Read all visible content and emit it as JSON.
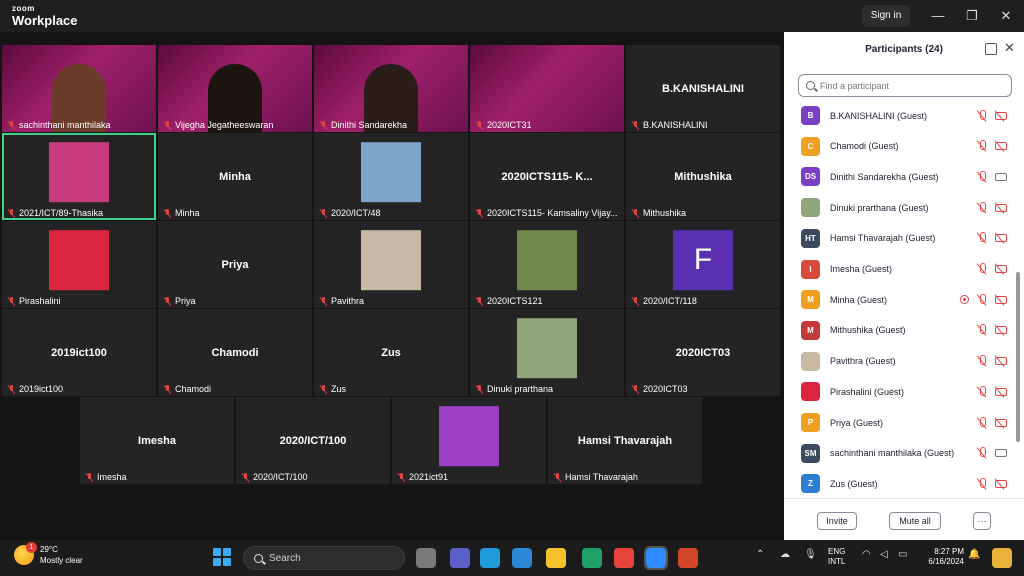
{
  "titlebar": {
    "brand_top": "zoom",
    "brand_bottom": "Workplace",
    "signin_label": "Sign in",
    "minimize_glyph": "—",
    "restore_glyph": "❐",
    "close_glyph": "✕"
  },
  "tiles": [
    {
      "label": "sachinthani manthilaka",
      "name": "",
      "kind": "banner"
    },
    {
      "label": "Vijegha Jegatheeswaran",
      "name": "",
      "kind": "banner"
    },
    {
      "label": "Dinithi Sandarekha",
      "name": "",
      "kind": "banner"
    },
    {
      "label": "2020ICT31",
      "name": "",
      "kind": "banner"
    },
    {
      "label": "B.KANISHALINI",
      "name": "B.KANISHALINI",
      "kind": "name"
    },
    {
      "label": "2021/ICT/89-Thasika",
      "name": "",
      "kind": "photo",
      "color": "#c73a7f"
    },
    {
      "label": "Minha",
      "name": "Minha",
      "kind": "name"
    },
    {
      "label": "2020/ICT/48",
      "name": "",
      "kind": "photo",
      "color": "#7ea4c9"
    },
    {
      "label": "2020ICTS115- Kamsaliny Vijay...",
      "name": "2020ICTS115- K...",
      "kind": "name"
    },
    {
      "label": "Mithushika",
      "name": "Mithushika",
      "kind": "name"
    },
    {
      "label": "Pirashalini",
      "name": "",
      "kind": "photo",
      "color": "#d9263e"
    },
    {
      "label": "Priya",
      "name": "Priya",
      "kind": "name"
    },
    {
      "label": "Pavithra",
      "name": "",
      "kind": "photo",
      "color": "#c9b9a4"
    },
    {
      "label": "2020ICTS121",
      "name": "",
      "kind": "photo",
      "color": "#6f8a4a"
    },
    {
      "label": "2020/ICT/118",
      "name": "",
      "kind": "letter",
      "letter": "F",
      "color": "#5a2fb0"
    },
    {
      "label": "2019ict100",
      "name": "2019ict100",
      "kind": "name"
    },
    {
      "label": "Chamodi",
      "name": "Chamodi",
      "kind": "name"
    },
    {
      "label": "Zus",
      "name": "Zus",
      "kind": "name"
    },
    {
      "label": "Dinuki prarthana",
      "name": "",
      "kind": "photo",
      "color": "#8fa57a"
    },
    {
      "label": "2020ICT03",
      "name": "2020ICT03",
      "kind": "name"
    },
    {
      "label": "Imesha",
      "name": "Imesha",
      "kind": "name"
    },
    {
      "label": "2020/ICT/100",
      "name": "2020/ICT/100",
      "kind": "name"
    },
    {
      "label": "2021ict91",
      "name": "",
      "kind": "photo",
      "color": "#9b3fc4"
    },
    {
      "label": "Hamsi Thavarajah",
      "name": "Hamsi Thavarajah",
      "kind": "name"
    }
  ],
  "panel": {
    "title": "Participants (24)",
    "search_placeholder": "Find a participant",
    "invite_label": "Invite",
    "mute_all_label": "Mute all",
    "more_label": "···",
    "participants": [
      {
        "initials": "B",
        "name": "B.KANISHALINI (Guest)",
        "color": "#7b3fc4",
        "cam_on": false,
        "rec": false
      },
      {
        "initials": "C",
        "name": "Chamodi (Guest)",
        "color": "#f0a020",
        "cam_on": false,
        "rec": false
      },
      {
        "initials": "DS",
        "name": "Dinithi Sandarekha (Guest)",
        "color": "#7b3fc4",
        "cam_on": true,
        "rec": false
      },
      {
        "initials": "",
        "name": "Dinuki prarthana (Guest)",
        "color": "#8fa57a",
        "cam_on": false,
        "rec": false
      },
      {
        "initials": "HT",
        "name": "Hamsi Thavarajah (Guest)",
        "color": "#3b4a5e",
        "cam_on": false,
        "rec": false
      },
      {
        "initials": "I",
        "name": "Imesha (Guest)",
        "color": "#d94a3a",
        "cam_on": false,
        "rec": false
      },
      {
        "initials": "M",
        "name": "Minha (Guest)",
        "color": "#f0a020",
        "cam_on": false,
        "rec": true
      },
      {
        "initials": "M",
        "name": "Mithushika (Guest)",
        "color": "#c23a3a",
        "cam_on": false,
        "rec": false
      },
      {
        "initials": "",
        "name": "Pavithra (Guest)",
        "color": "#c9b9a4",
        "cam_on": false,
        "rec": false
      },
      {
        "initials": "",
        "name": "Pirashalini (Guest)",
        "color": "#d9263e",
        "cam_on": false,
        "rec": false
      },
      {
        "initials": "P",
        "name": "Priya (Guest)",
        "color": "#f0a020",
        "cam_on": false,
        "rec": false
      },
      {
        "initials": "SM",
        "name": "sachinthani manthilaka (Guest)",
        "color": "#3b4a5e",
        "cam_on": true,
        "rec": false
      },
      {
        "initials": "Z",
        "name": "Zus (Guest)",
        "color": "#2d7fd3",
        "cam_on": false,
        "rec": false
      }
    ]
  },
  "taskbar": {
    "weather_badge": "1",
    "temperature": "29°C",
    "condition": "Mostly clear",
    "search_label": "Search",
    "lang_top": "ENG",
    "lang_bottom": "INTL",
    "time": "8:27 PM",
    "date": "6/16/2024",
    "apps": [
      {
        "icon": "file-explorer-icon",
        "color": "#7a7a7a"
      },
      {
        "icon": "teams-icon",
        "color": "#5b5fc7"
      },
      {
        "icon": "edge-icon",
        "color": "#1f9bd9"
      },
      {
        "icon": "store-icon",
        "color": "#2b88d8"
      },
      {
        "icon": "folder-icon",
        "color": "#f4c12b"
      },
      {
        "icon": "photos-icon",
        "color": "#1fa36a"
      },
      {
        "icon": "chrome-icon",
        "color": "#e8453c"
      },
      {
        "icon": "zoom-icon",
        "color": "#2d8cff"
      },
      {
        "icon": "powerpoint-icon",
        "color": "#d24726"
      }
    ]
  }
}
